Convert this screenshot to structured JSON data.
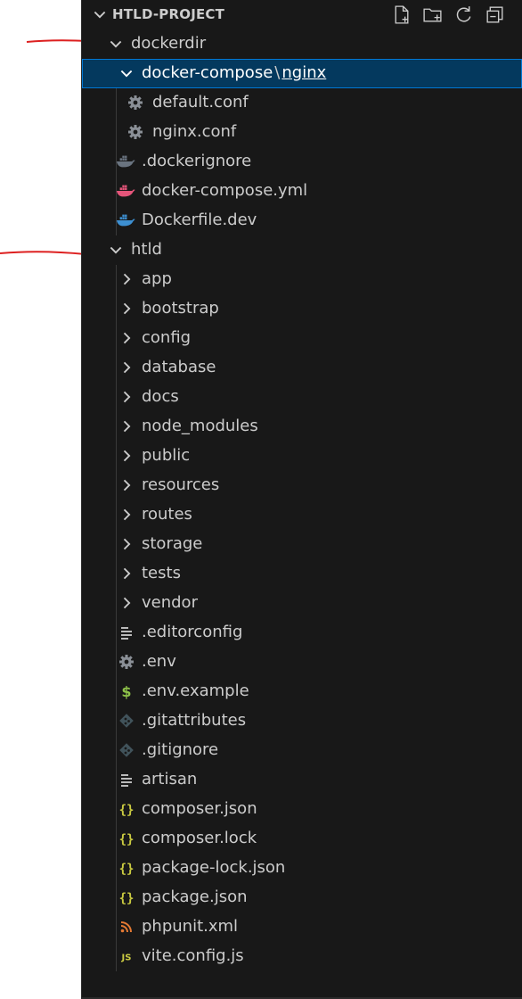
{
  "explorer": {
    "project_title": "HTLD-PROJECT",
    "header_actions": [
      {
        "name": "new-file-icon"
      },
      {
        "name": "new-folder-icon"
      },
      {
        "name": "refresh-icon"
      },
      {
        "name": "collapse-all-icon"
      }
    ]
  },
  "tree": {
    "dockerdir": "dockerdir",
    "compact_folder": {
      "part1": "docker-compose",
      "separator": "\\",
      "part2": "nginx"
    },
    "default_conf": "default.conf",
    "nginx_conf": "nginx.conf",
    "dockerignore": ".dockerignore",
    "docker_compose_yml": "docker-compose.yml",
    "dockerfile_dev": "Dockerfile.dev",
    "htld": "htld",
    "folders": [
      "app",
      "bootstrap",
      "config",
      "database",
      "docs",
      "node_modules",
      "public",
      "resources",
      "routes",
      "storage",
      "tests",
      "vendor"
    ],
    "files": [
      {
        "label": ".editorconfig",
        "icon": "lines-icon"
      },
      {
        "label": ".env",
        "icon": "gear-icon"
      },
      {
        "label": ".env.example",
        "icon": "dollar-icon"
      },
      {
        "label": ".gitattributes",
        "icon": "git-icon"
      },
      {
        "label": ".gitignore",
        "icon": "git-icon"
      },
      {
        "label": "artisan",
        "icon": "lines-icon"
      },
      {
        "label": "composer.json",
        "icon": "braces-icon"
      },
      {
        "label": "composer.lock",
        "icon": "braces-icon"
      },
      {
        "label": "package-lock.json",
        "icon": "braces-icon"
      },
      {
        "label": "package.json",
        "icon": "braces-icon"
      },
      {
        "label": "phpunit.xml",
        "icon": "rss-icon"
      },
      {
        "label": "vite.config.js",
        "icon": "js-icon"
      }
    ]
  },
  "colors": {
    "background": "#181818",
    "selection": "#04395e",
    "selection_border": "#0078d4",
    "text": "#cccccc",
    "docker_gray": "#6a7480",
    "docker_pink": "#e5557a",
    "docker_blue": "#3d8fd1",
    "json_yellow": "#cbcb41",
    "dollar_green": "#8dc149",
    "rss_orange": "#e37933",
    "annotation_red": "#dd2020"
  }
}
